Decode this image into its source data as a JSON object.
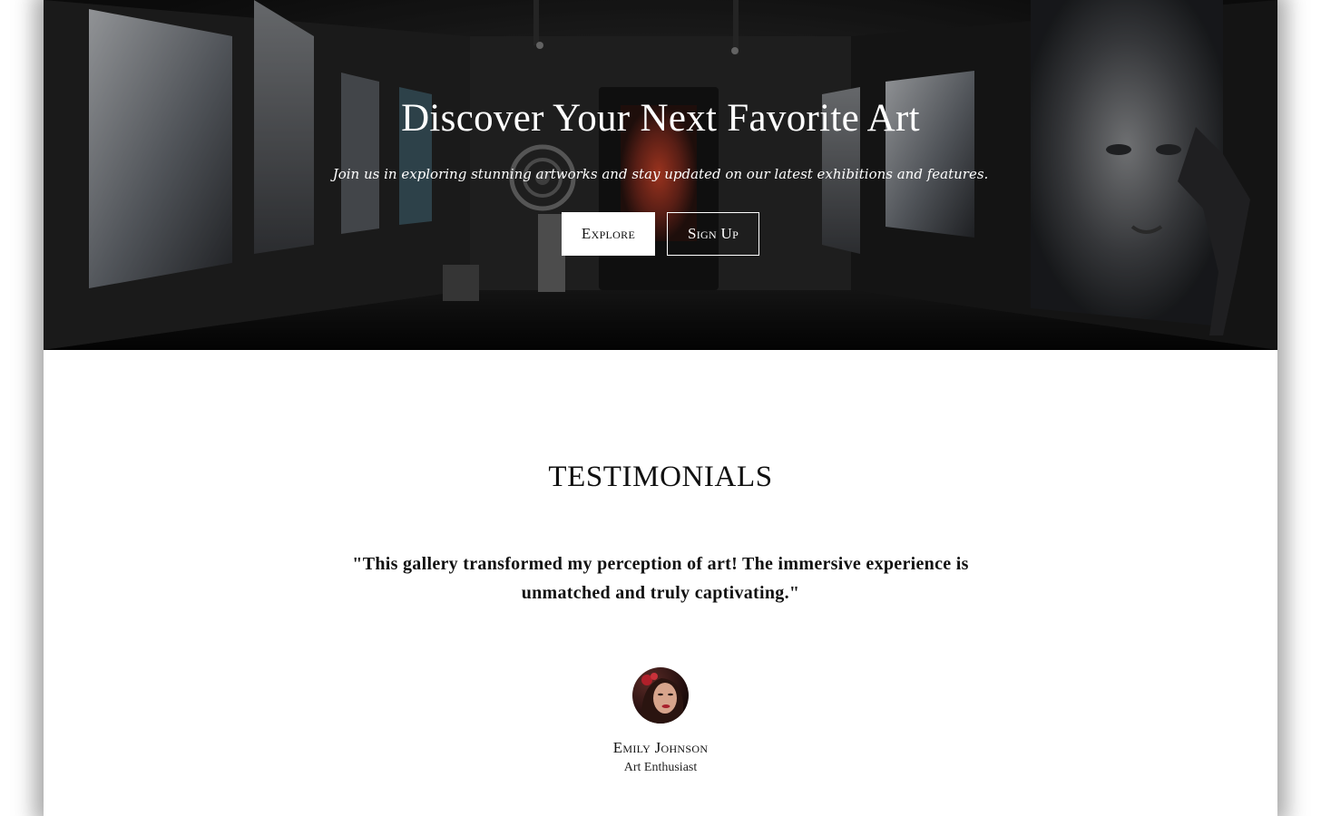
{
  "hero": {
    "title": "Discover Your Next Favorite Art",
    "subtitle": "Join us in exploring stunning artworks and stay updated on our latest exhibitions and features.",
    "explore_label": "Explore",
    "signup_label": "Sign Up",
    "background_image": "dark art gallery interior with lit paintings and sculptures"
  },
  "testimonials": {
    "heading": "TESTIMONIALS",
    "quote": "\"This gallery transformed my perception of art! The immersive experience is unmatched and truly captivating.\"",
    "author_name": "Emily Johnson",
    "author_role": "Art Enthusiast",
    "avatar_image": "portrait of a woman with red flowers in her hair"
  },
  "colors": {
    "hero_overlay": "#000000",
    "text_dark": "#111111",
    "text_light": "#ffffff",
    "page_background": "#ffffff"
  }
}
